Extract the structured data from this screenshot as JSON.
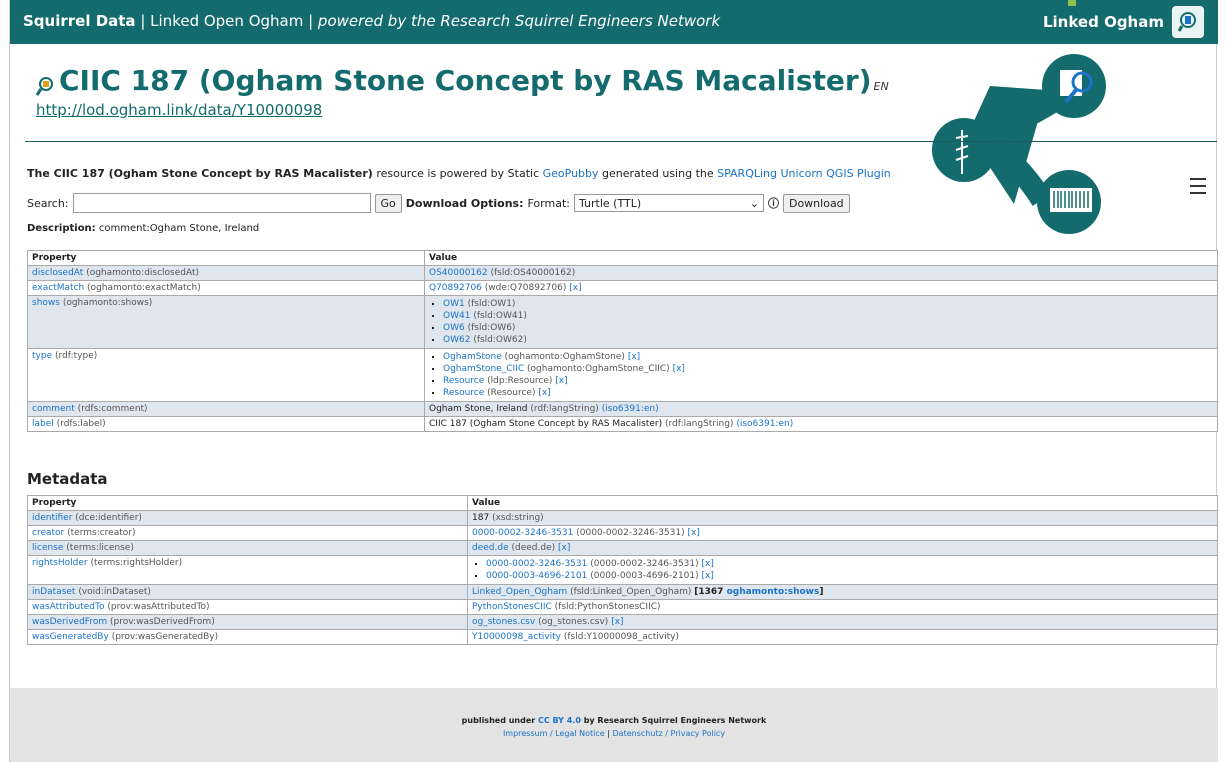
{
  "header": {
    "brand": "Squirrel Data",
    "site": "Linked Open Ogham",
    "powered": "powered by the Research Squirrel Engineers Network",
    "right_label": "Linked Ogham"
  },
  "title": {
    "text": "CIIC 187 (Ogham Stone Concept by RAS Macalister)",
    "lang": "EN"
  },
  "uri": "http://lod.ogham.link/data/Y10000098",
  "powered_line": {
    "bold": "The CIIC 187 (Ogham Stone Concept by RAS Macalister)",
    "mid1": " resource is powered by Static ",
    "link1": "GeoPubby",
    "mid2": " generated using the ",
    "link2": "SPARQLing Unicorn QGIS Plugin"
  },
  "search": {
    "label": "Search:",
    "go": "Go",
    "download_options": "Download Options:",
    "format_label": "Format:",
    "format_value": "Turtle (TTL)",
    "download": "Download"
  },
  "description": {
    "label": "Description:",
    "value": "comment:Ogham Stone, Ireland"
  },
  "main_table": {
    "headers": [
      "Property",
      "Value"
    ],
    "rows": [
      {
        "p": "disclosedAt",
        "pg": "(oghamonto:disclosedAt)",
        "items": [
          {
            "link": "OS40000162",
            "gray": "(fsld:OS40000162)",
            "x": ""
          }
        ]
      },
      {
        "p": "exactMatch",
        "pg": "(oghamonto:exactMatch)",
        "items": [
          {
            "link": "Q70892706",
            "gray": "(wde:Q70892706)",
            "x": "[x]"
          }
        ]
      },
      {
        "p": "shows",
        "pg": "(oghamonto:shows)",
        "list": [
          {
            "link": "OW1",
            "gray": "(fsld:OW1)",
            "x": ""
          },
          {
            "link": "OW41",
            "gray": "(fsld:OW41)",
            "x": ""
          },
          {
            "link": "OW6",
            "gray": "(fsld:OW6)",
            "x": ""
          },
          {
            "link": "OW62",
            "gray": "(fsld:OW62)",
            "x": ""
          }
        ]
      },
      {
        "p": "type",
        "pg": "(rdf:type)",
        "list": [
          {
            "link": "OghamStone",
            "gray": "(oghamonto:OghamStone)",
            "x": "[x]"
          },
          {
            "link": "OghamStone_CIIC",
            "gray": "(oghamonto:OghamStone_CIIC)",
            "x": "[x]"
          },
          {
            "link": "Resource",
            "gray": "(ldp:Resource)",
            "x": "[x]"
          },
          {
            "link": "Resource",
            "gray": "(Resource)",
            "x": "[x]"
          }
        ]
      },
      {
        "p": "comment",
        "pg": "(rdfs:comment)",
        "items": [
          {
            "plain": "Ogham Stone, Ireland",
            "gray": "(rdf:langString)",
            "link2": "(iso6391:en)"
          }
        ]
      },
      {
        "p": "label",
        "pg": "(rdfs:label)",
        "items": [
          {
            "plain": "CIIC 187 (Ogham Stone Concept by RAS Macalister)",
            "gray": "(rdf:langString)",
            "link2": "(iso6391:en)"
          }
        ]
      }
    ]
  },
  "metadata_heading": "Metadata",
  "meta_table": {
    "headers": [
      "Property",
      "Value"
    ],
    "rows": [
      {
        "p": "identifier",
        "pg": "(dce:identifier)",
        "items": [
          {
            "plain": "187",
            "gray": "(xsd:string)"
          }
        ]
      },
      {
        "p": "creator",
        "pg": "(terms:creator)",
        "items": [
          {
            "link": "0000-0002-3246-3531",
            "gray": "(0000-0002-3246-3531)",
            "x": "[x]"
          }
        ]
      },
      {
        "p": "license",
        "pg": "(terms:license)",
        "items": [
          {
            "link": "deed.de",
            "gray": "(deed.de)",
            "x": "[x]"
          }
        ]
      },
      {
        "p": "rightsHolder",
        "pg": "(terms:rightsHolder)",
        "list": [
          {
            "link": "0000-0002-3246-3531",
            "gray": "(0000-0002-3246-3531)",
            "x": "[x]"
          },
          {
            "link": "0000-0003-4696-2101",
            "gray": "(0000-0003-4696-2101)",
            "x": "[x]"
          }
        ]
      },
      {
        "p": "inDataset",
        "pg": "(void:inDataset)",
        "items": [
          {
            "link": "Linked_Open_Ogham",
            "gray": "(fsld:Linked_Open_Ogham)",
            "bold": "[1367",
            "boldlink": "oghamonto:shows",
            "boldend": "]"
          }
        ]
      },
      {
        "p": "wasAttributedTo",
        "pg": "(prov:wasAttributedTo)",
        "items": [
          {
            "link": "PythonStonesCIIC",
            "gray": "(fsld:PythonStonesCIIC)"
          }
        ]
      },
      {
        "p": "wasDerivedFrom",
        "pg": "(prov:wasDerivedFrom)",
        "items": [
          {
            "link": "og_stones.csv",
            "gray": "(og_stones.csv)",
            "x": "[x]"
          }
        ]
      },
      {
        "p": "wasGeneratedBy",
        "pg": "(prov:wasGeneratedBy)",
        "items": [
          {
            "link": "Y10000098_activity",
            "gray": "(fsld:Y10000098_activity)"
          }
        ]
      }
    ]
  },
  "footer": {
    "pre": "published under ",
    "license": "CC BY 4.0",
    "post": " by Research Squirrel Engineers Network",
    "impressum": "Impressum / Legal Notice",
    "sep": " | ",
    "privacy": "Datenschutz / Privacy Policy"
  },
  "colors": {
    "header_bg": "#136b6d",
    "link": "#1a73c8",
    "row_alt": "#dfe6ee"
  }
}
